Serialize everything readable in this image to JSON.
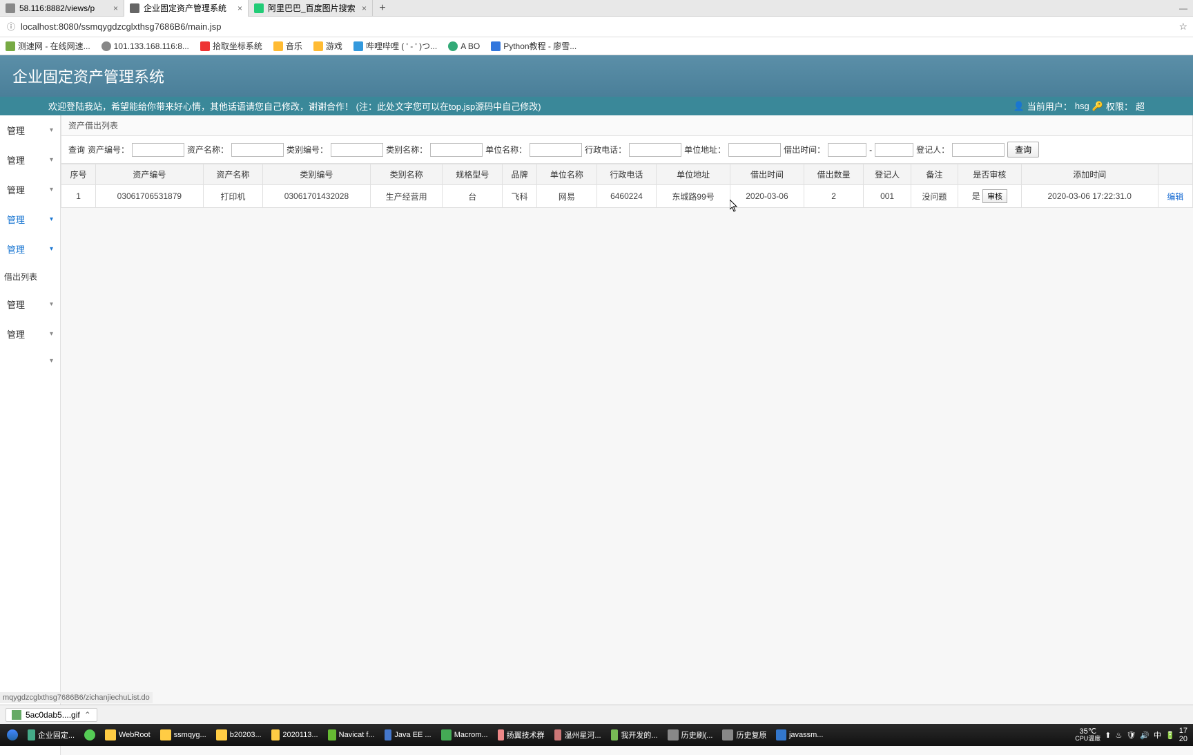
{
  "browser": {
    "tabs": [
      {
        "title": "58.116:8882/views/p",
        "favicon": "#888"
      },
      {
        "title": "企业固定资产管理系统",
        "favicon": "#666",
        "active": true
      },
      {
        "title": "阿里巴巴_百度图片搜索",
        "favicon": "#2c7"
      }
    ],
    "url": "localhost:8080/ssmqygdzcglxthsg7686B6/main.jsp",
    "bookmarks": [
      {
        "label": "测速网 - 在线网速...",
        "color": "#7a4"
      },
      {
        "label": "101.133.168.116:8...",
        "color": "#888"
      },
      {
        "label": "拾取坐标系统",
        "color": "#e33"
      },
      {
        "label": "音乐",
        "color": "#fb3"
      },
      {
        "label": "游戏",
        "color": "#fb3"
      },
      {
        "label": "哔哩哔哩 (  ' - ' )つ...",
        "color": "#39d"
      },
      {
        "label": "A BO",
        "color": "#3a7"
      },
      {
        "label": "Python教程 - 廖雪...",
        "color": "#37d"
      }
    ]
  },
  "app": {
    "title": "企业固定资产管理系统",
    "welcome": "欢迎登陆我站，希望能给你带来好心情，其他话语请您自己修改，谢谢合作！   (注：此处文字您可以在top.jsp源码中自己修改)",
    "user_label": "当前用户：",
    "user_name": "hsg",
    "perm_label": "权限：",
    "perm_value": "超"
  },
  "sidebar": {
    "items": [
      {
        "label": "管理",
        "active": false
      },
      {
        "label": "管理",
        "active": false
      },
      {
        "label": "管理",
        "active": false
      },
      {
        "label": "管理",
        "active": true
      },
      {
        "label": "管理",
        "active": true
      }
    ],
    "sub": "借出列表",
    "items2": [
      {
        "label": "管理"
      },
      {
        "label": "管理"
      },
      {
        "label": ""
      }
    ]
  },
  "panel": {
    "title": "资产借出列表"
  },
  "search": {
    "prefix": "查询",
    "fields": {
      "asset_no": "资产编号：",
      "asset_name": "资产名称：",
      "cat_no": "类别编号：",
      "cat_name": "类别名称：",
      "unit_name": "单位名称：",
      "phone": "行政电话：",
      "addr": "单位地址：",
      "lend_time": "借出时间：",
      "registrar": "登记人："
    },
    "button": "查询"
  },
  "table": {
    "headers": [
      "序号",
      "资产编号",
      "资产名称",
      "类别编号",
      "类别名称",
      "规格型号",
      "品牌",
      "单位名称",
      "行政电话",
      "单位地址",
      "借出时间",
      "借出数量",
      "登记人",
      "备注",
      "是否审核",
      "添加时间",
      ""
    ],
    "rows": [
      {
        "seq": "1",
        "asset_no": "03061706531879",
        "asset_name": "打印机",
        "cat_no": "03061701432028",
        "cat_name": "生产经营用",
        "spec": "台",
        "brand": "飞科",
        "unit": "网易",
        "phone": "6460224",
        "addr": "东城路99号",
        "date": "2020-03-06",
        "qty": "2",
        "reg": "001",
        "note": "没问题",
        "audit_flag": "是",
        "audit_btn": "审核",
        "add_time": "2020-03-06 17:22:31.0",
        "edit": "编辑"
      }
    ]
  },
  "status_url": "mqygdzcglxthsg7686B6/zichanjiechuList.do",
  "download": {
    "file": "5ac0dab5....gif"
  },
  "taskbar": {
    "items": [
      {
        "label": "企业固定...",
        "color": "#4a8"
      },
      {
        "label": "",
        "color": "#5c5"
      },
      {
        "label": "WebRoot",
        "color": "#fc4"
      },
      {
        "label": "ssmqyg...",
        "color": "#fc4"
      },
      {
        "label": "b20203...",
        "color": "#fc4"
      },
      {
        "label": "2020113...",
        "color": "#fc4"
      },
      {
        "label": "Navicat f...",
        "color": "#6b3"
      },
      {
        "label": "Java EE ...",
        "color": "#47c"
      },
      {
        "label": "Macrom...",
        "color": "#4a5"
      },
      {
        "label": "扬翼技术群",
        "color": "#e88"
      },
      {
        "label": "温州星河...",
        "color": "#c77"
      },
      {
        "label": "我开发的...",
        "color": "#7b5"
      },
      {
        "label": "历史刷(...",
        "color": "#888"
      },
      {
        "label": "历史复原",
        "color": "#888"
      },
      {
        "label": "javassm...",
        "color": "#37c"
      }
    ],
    "temp": "35℃",
    "cpu": "CPU温度",
    "time1": "17",
    "time2": "20"
  }
}
